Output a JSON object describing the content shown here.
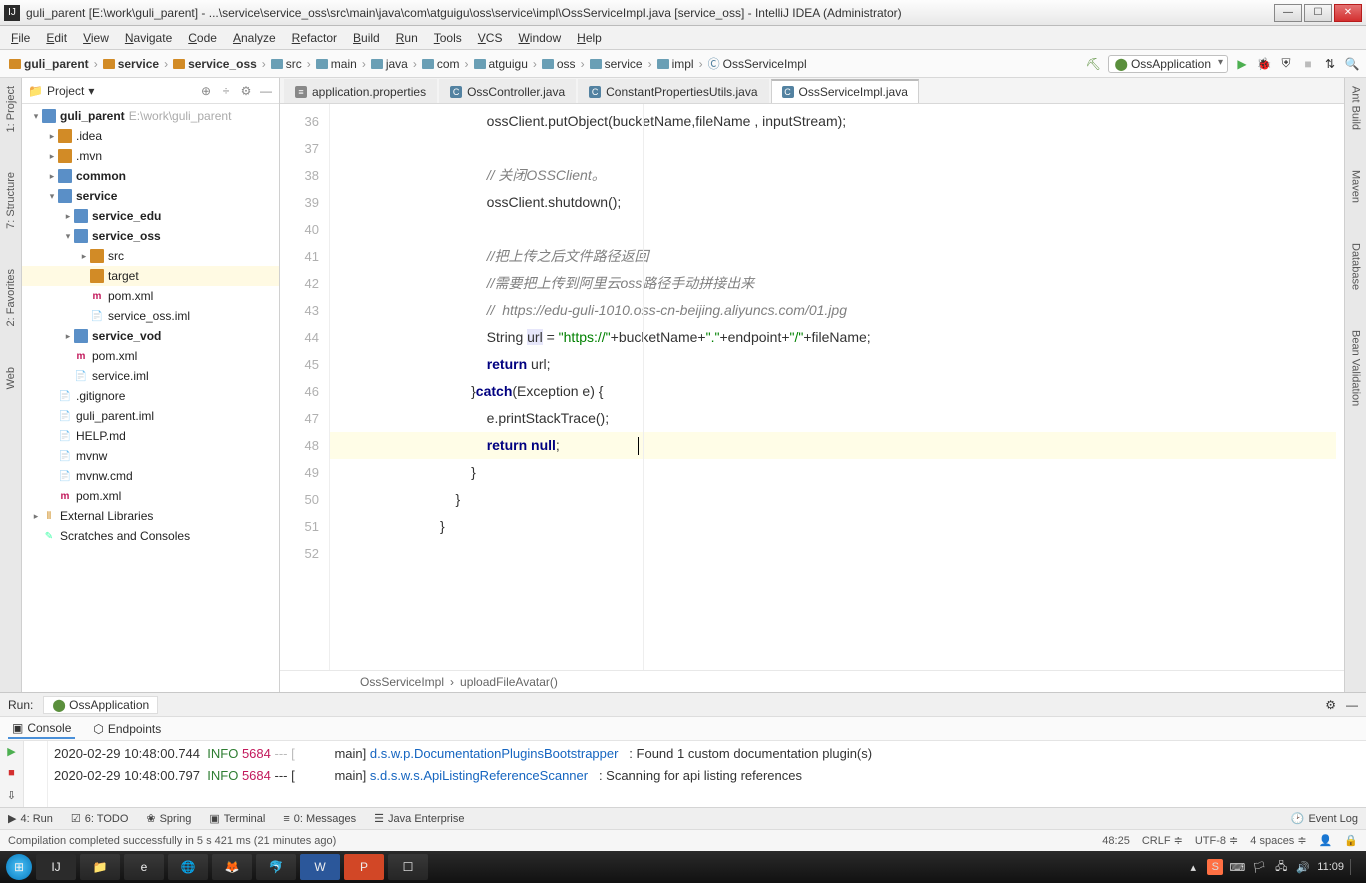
{
  "window": {
    "title": "guli_parent [E:\\work\\guli_parent] - ...\\service\\service_oss\\src\\main\\java\\com\\atguigu\\oss\\service\\impl\\OssServiceImpl.java [service_oss] - IntelliJ IDEA (Administrator)"
  },
  "menu": [
    "File",
    "Edit",
    "View",
    "Navigate",
    "Code",
    "Analyze",
    "Refactor",
    "Build",
    "Run",
    "Tools",
    "VCS",
    "Window",
    "Help"
  ],
  "nav_crumbs": [
    "guli_parent",
    "service",
    "service_oss",
    "src",
    "main",
    "java",
    "com",
    "atguigu",
    "oss",
    "service",
    "impl",
    "OssServiceImpl"
  ],
  "nav_crumb_bold": [
    true,
    true,
    true,
    false,
    false,
    false,
    false,
    false,
    false,
    false,
    false,
    false
  ],
  "run_config": "OssApplication",
  "left_tabs": [
    "1: Project",
    "7: Structure",
    "2: Favorites",
    "Web"
  ],
  "right_tabs": [
    "Ant Build",
    "Maven",
    "Database",
    "Bean Validation"
  ],
  "project_header": {
    "title": "Project"
  },
  "tree": [
    {
      "d": 0,
      "arrow": "▾",
      "icon": "folder-mod",
      "label": "guli_parent",
      "bold": true,
      "hint": "E:\\work\\guli_parent"
    },
    {
      "d": 1,
      "arrow": "▸",
      "icon": "folder",
      "label": ".idea"
    },
    {
      "d": 1,
      "arrow": "▸",
      "icon": "folder",
      "label": ".mvn"
    },
    {
      "d": 1,
      "arrow": "▸",
      "icon": "folder-mod",
      "label": "common",
      "bold": true
    },
    {
      "d": 1,
      "arrow": "▾",
      "icon": "folder-mod",
      "label": "service",
      "bold": true
    },
    {
      "d": 2,
      "arrow": "▸",
      "icon": "folder-mod",
      "label": "service_edu",
      "bold": true
    },
    {
      "d": 2,
      "arrow": "▾",
      "icon": "folder-mod",
      "label": "service_oss",
      "bold": true
    },
    {
      "d": 3,
      "arrow": "▸",
      "icon": "folder",
      "label": "src"
    },
    {
      "d": 3,
      "arrow": "",
      "icon": "folder",
      "label": "target",
      "sel": true
    },
    {
      "d": 3,
      "arrow": "",
      "icon": "maven",
      "label": "pom.xml"
    },
    {
      "d": 3,
      "arrow": "",
      "icon": "file",
      "label": "service_oss.iml"
    },
    {
      "d": 2,
      "arrow": "▸",
      "icon": "folder-mod",
      "label": "service_vod",
      "bold": true
    },
    {
      "d": 2,
      "arrow": "",
      "icon": "maven",
      "label": "pom.xml"
    },
    {
      "d": 2,
      "arrow": "",
      "icon": "file",
      "label": "service.iml"
    },
    {
      "d": 1,
      "arrow": "",
      "icon": "file",
      "label": ".gitignore"
    },
    {
      "d": 1,
      "arrow": "",
      "icon": "file",
      "label": "guli_parent.iml"
    },
    {
      "d": 1,
      "arrow": "",
      "icon": "file",
      "label": "HELP.md"
    },
    {
      "d": 1,
      "arrow": "",
      "icon": "file",
      "label": "mvnw"
    },
    {
      "d": 1,
      "arrow": "",
      "icon": "file",
      "label": "mvnw.cmd"
    },
    {
      "d": 1,
      "arrow": "",
      "icon": "maven",
      "label": "pom.xml"
    },
    {
      "d": 0,
      "arrow": "▸",
      "icon": "lib",
      "label": "External Libraries"
    },
    {
      "d": 0,
      "arrow": "",
      "icon": "scratch",
      "label": "Scratches and Consoles"
    }
  ],
  "editor_tabs": [
    {
      "label": "application.properties",
      "type": "prop"
    },
    {
      "label": "OssController.java",
      "type": "java"
    },
    {
      "label": "ConstantPropertiesUtils.java",
      "type": "java"
    },
    {
      "label": "OssServiceImpl.java",
      "type": "java",
      "active": true
    }
  ],
  "gutter_lines": [
    "36",
    "37",
    "38",
    "39",
    "40",
    "41",
    "42",
    "43",
    "44",
    "45",
    "46",
    "47",
    "48",
    "49",
    "50",
    "51",
    "52"
  ],
  "code_lines": [
    {
      "t": "ossClient.putObject(bucketName,fileName , inputStream);",
      "p": 3
    },
    {
      "t": "",
      "p": 3
    },
    {
      "t": "// 关闭OSSClient。",
      "p": 3,
      "cm": true
    },
    {
      "t": "ossClient.shutdown();",
      "p": 3
    },
    {
      "t": "",
      "p": 3
    },
    {
      "t": "//把上传之后文件路径返回",
      "p": 3,
      "cm": true
    },
    {
      "t": "//需要把上传到阿里云oss路径手动拼接出来",
      "p": 3,
      "cm": true
    },
    {
      "t": "//  https://edu-guli-1010.oss-cn-beijing.aliyuncs.com/01.jpg",
      "p": 3,
      "cm": true
    },
    {
      "html": "String <span class=\"var-hl\">url</span> = <span class=\"str\">\"https://\"</span>+bucketName+<span class=\"str\">\".\"</span>+endpoint+<span class=\"str\">\"/\"</span>+fileName;",
      "p": 3
    },
    {
      "html": "<span class=\"kw\">return</span> url;",
      "p": 3
    },
    {
      "html": "}<span class=\"kw\">catch</span>(Exception e) {",
      "p": 2
    },
    {
      "t": "e.printStackTrace();",
      "p": 3
    },
    {
      "html": "<span class=\"kw\">return null</span>;",
      "p": 3,
      "hl": true,
      "cursor": true
    },
    {
      "t": "}",
      "p": 2
    },
    {
      "t": "}",
      "p": 1
    },
    {
      "t": "}",
      "p": 0
    },
    {
      "t": "",
      "p": 0
    }
  ],
  "breadcrumb": [
    "OssServiceImpl",
    "uploadFileAvatar()"
  ],
  "run": {
    "title": "Run:",
    "config": "OssApplication",
    "tabs": [
      {
        "label": "Console",
        "active": true
      },
      {
        "label": "Endpoints"
      }
    ],
    "lines": [
      {
        "ts": "2020-02-29 10:48:00.744",
        "lvl": "INFO",
        "pid": "5684",
        "sep": "--- [",
        "thread": "main]",
        "logger": "d.s.w.p.DocumentationPluginsBootstrapper",
        "msg": ": Found 1 custom documentation plugin(s)",
        "faded": true
      },
      {
        "ts": "2020-02-29 10:48:00.797",
        "lvl": "INFO",
        "pid": "5684",
        "sep": "--- [",
        "thread": "main]",
        "logger": "s.d.s.w.s.ApiListingReferenceScanner",
        "msg": ": Scanning for api listing references"
      }
    ]
  },
  "bottom_tools": [
    "4: Run",
    "6: TODO",
    "Spring",
    "Terminal",
    "0: Messages",
    "Java Enterprise"
  ],
  "event_log": "Event Log",
  "status": {
    "msg": "Compilation completed successfully in 5 s 421 ms (21 minutes ago)",
    "pos": "48:25",
    "eol": "CRLF",
    "enc": "UTF-8",
    "indent": "4 spaces"
  },
  "taskbar": {
    "time": "11:09"
  }
}
